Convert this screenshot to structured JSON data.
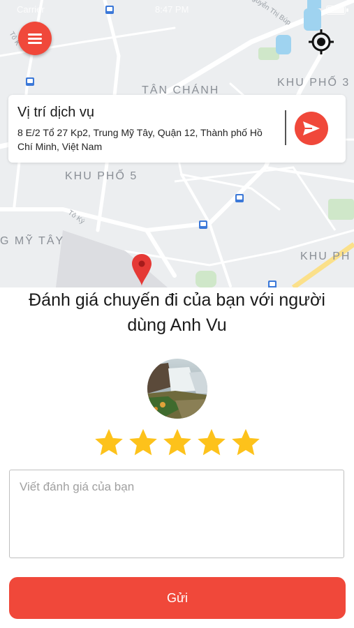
{
  "status_bar": {
    "carrier": "Carrier",
    "time": "8:47 PM"
  },
  "map": {
    "labels": {
      "tan_chanh": "TÂN CHÁNH",
      "khu_pho_3": "KHU PHỐ 3",
      "khu_pho_5": "KHU PHỐ 5",
      "trung_my_tay": "G MỸ TÂY",
      "khu_ph": "KHU PH",
      "to_ky": "Tô Ký",
      "to_ky_top": "Tô K",
      "nguyen_thi_bup": "Nguyễn Thị Búp"
    }
  },
  "location_card": {
    "title": "Vị trí dịch vụ",
    "address": "8 E/2 Tổ 27 Kp2, Trung Mỹ Tây, Quận 12, Thành phố Hồ Chí Minh, Việt Nam"
  },
  "rating": {
    "heading": "Đánh giá chuyến đi của bạn với người dùng Anh Vu",
    "stars": 5,
    "star_color": "#fdc21b",
    "review_placeholder": "Viết đánh giá của bạn",
    "review_value": "",
    "submit_label": "Gửi"
  },
  "colors": {
    "accent": "#f0483a",
    "map_bg": "#eceef0"
  },
  "icons": {
    "menu": "hamburger-icon",
    "locate": "crosshair-icon",
    "send": "send-icon",
    "pin": "map-pin-icon",
    "star": "star-icon"
  }
}
